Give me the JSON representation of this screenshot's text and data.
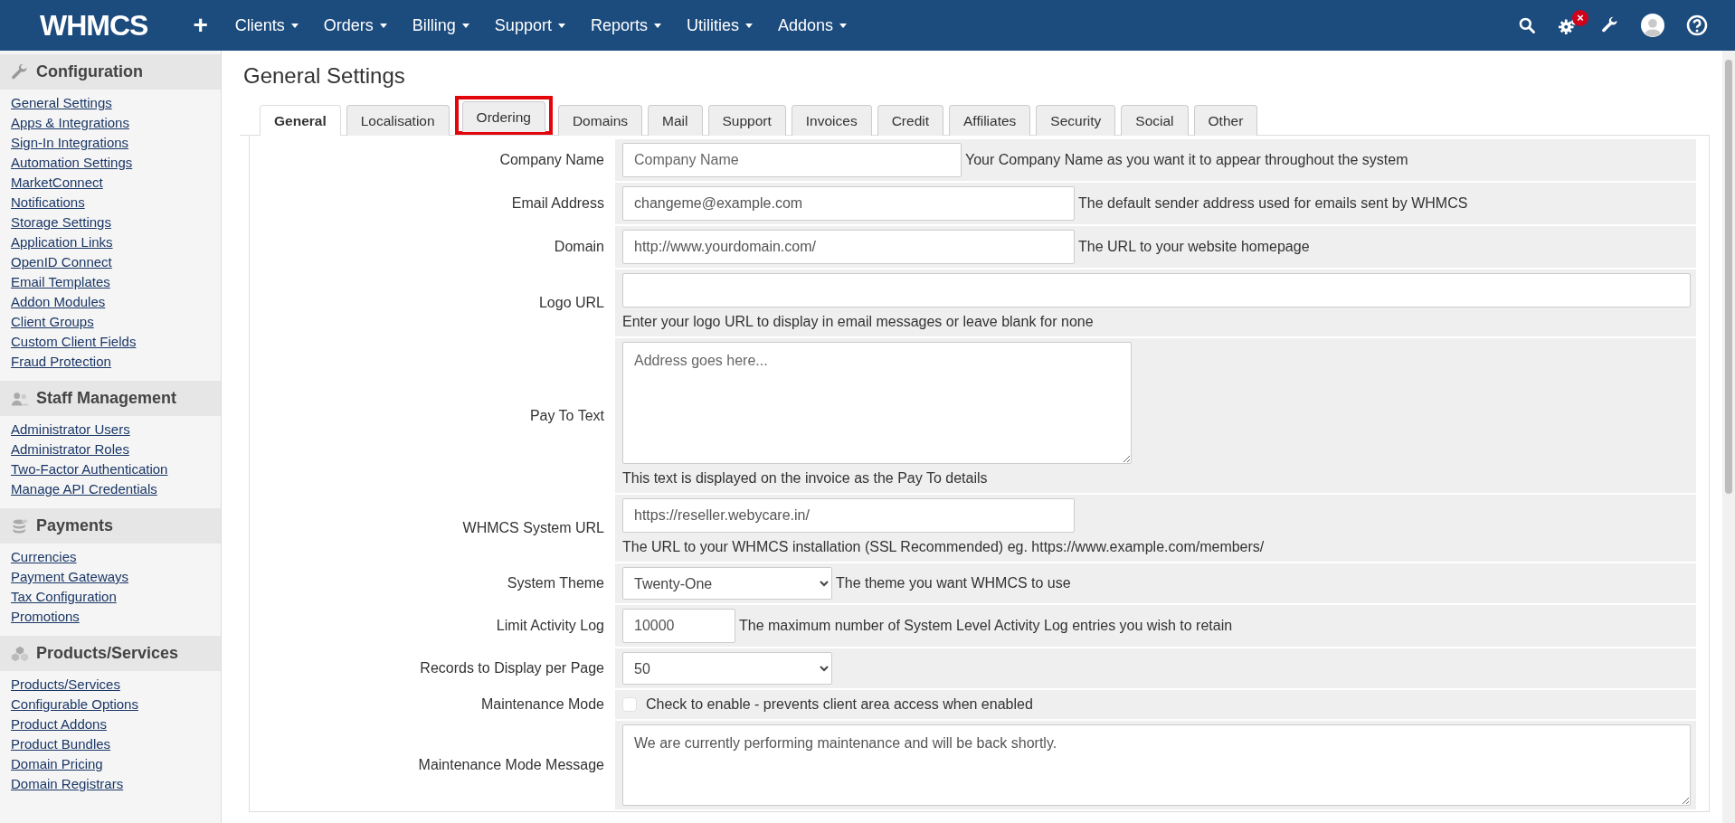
{
  "navbar": {
    "logo": "WHMCS",
    "add": "+",
    "menus": [
      "Clients",
      "Orders",
      "Billing",
      "Support",
      "Reports",
      "Utilities",
      "Addons"
    ],
    "alert_badge": "×"
  },
  "sidebar": [
    {
      "title": "Configuration",
      "links": [
        "General Settings",
        "Apps & Integrations",
        "Sign-In Integrations",
        "Automation Settings",
        "MarketConnect",
        "Notifications",
        "Storage Settings",
        "Application Links",
        "OpenID Connect",
        "Email Templates",
        "Addon Modules",
        "Client Groups",
        "Custom Client Fields",
        "Fraud Protection"
      ]
    },
    {
      "title": "Staff Management",
      "links": [
        "Administrator Users",
        "Administrator Roles",
        "Two-Factor Authentication",
        "Manage API Credentials"
      ]
    },
    {
      "title": "Payments",
      "links": [
        "Currencies",
        "Payment Gateways",
        "Tax Configuration",
        "Promotions"
      ]
    },
    {
      "title": "Products/Services",
      "links": [
        "Products/Services",
        "Configurable Options",
        "Product Addons",
        "Product Bundles",
        "Domain Pricing",
        "Domain Registrars"
      ]
    }
  ],
  "page_title": "General Settings",
  "tabs": [
    {
      "label": "General",
      "selected": true,
      "highlighted": false
    },
    {
      "label": "Localisation",
      "selected": false,
      "highlighted": false
    },
    {
      "label": "Ordering",
      "selected": false,
      "highlighted": true
    },
    {
      "label": "Domains",
      "selected": false,
      "highlighted": false
    },
    {
      "label": "Mail",
      "selected": false,
      "highlighted": false
    },
    {
      "label": "Support",
      "selected": false,
      "highlighted": false
    },
    {
      "label": "Invoices",
      "selected": false,
      "highlighted": false
    },
    {
      "label": "Credit",
      "selected": false,
      "highlighted": false
    },
    {
      "label": "Affiliates",
      "selected": false,
      "highlighted": false
    },
    {
      "label": "Security",
      "selected": false,
      "highlighted": false
    },
    {
      "label": "Social",
      "selected": false,
      "highlighted": false
    },
    {
      "label": "Other",
      "selected": false,
      "highlighted": false
    }
  ],
  "fields": [
    {
      "kind": "text",
      "label": "Company Name",
      "placeholder": "Company Name",
      "help": "Your Company Name as you want it to appear throughout the system"
    },
    {
      "kind": "text",
      "label": "Email Address",
      "value": "changeme@example.com",
      "help": "The default sender address used for emails sent by WHMCS"
    },
    {
      "kind": "text",
      "label": "Domain",
      "value": "http://www.yourdomain.com/",
      "help": "The URL to your website homepage"
    },
    {
      "kind": "text",
      "label": "Logo URL",
      "help": "Enter your logo URL to display in email messages or leave blank for none"
    },
    {
      "kind": "textarea",
      "label": "Pay To Text",
      "placeholder": "Address goes here...",
      "help": "This text is displayed on the invoice as the Pay To details"
    },
    {
      "kind": "text",
      "label": "WHMCS System URL",
      "value": "https://reseller.webycare.in/",
      "help": "The URL to your WHMCS installation (SSL Recommended) eg. https://www.example.com/members/"
    },
    {
      "kind": "select",
      "label": "System Theme",
      "value": "Twenty-One",
      "help": "The theme you want WHMCS to use"
    },
    {
      "kind": "text",
      "label": "Limit Activity Log",
      "value": "10000",
      "help": "The maximum number of System Level Activity Log entries you wish to retain"
    },
    {
      "kind": "select",
      "label": "Records to Display per Page",
      "value": "50"
    },
    {
      "kind": "checkbox",
      "label": "Maintenance Mode",
      "checked": false,
      "help": "Check to enable - prevents client area access when enabled"
    },
    {
      "kind": "textarea",
      "label": "Maintenance Mode Message",
      "value": "We are currently performing maintenance and will be back shortly."
    }
  ]
}
